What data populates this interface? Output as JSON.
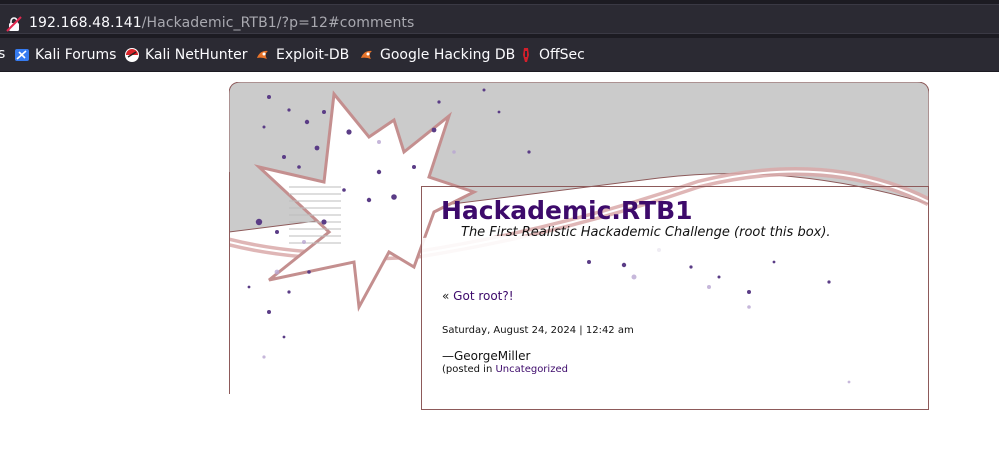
{
  "browser": {
    "url_host": "192.168.48.141",
    "url_path": "/Hackademic_RTB1/?p=12#comments",
    "bookmarks_edge": "s",
    "bookmarks": [
      {
        "label": "Kali Forums",
        "icon": "kali-forums-icon"
      },
      {
        "label": "Kali NetHunter",
        "icon": "kali-nethunter-icon"
      },
      {
        "label": "Exploit-DB",
        "icon": "exploit-db-icon"
      },
      {
        "label": "Google Hacking DB",
        "icon": "google-hacking-db-icon"
      },
      {
        "label": "OffSec",
        "icon": "offsec-icon"
      }
    ]
  },
  "blog": {
    "title": "Hackademic.RTB1",
    "description": "The First Realistic Hackademic Challenge (root this box)."
  },
  "post": {
    "prev_arrow": "«",
    "prev_link": "Got root?!",
    "date": "Saturday, August 24, 2024 | 12:42 am",
    "author": "—GeorgeMiller",
    "posted_in_prefix": "(posted in",
    "category": "Uncategorized"
  },
  "colors": {
    "title": "#3d0a6b",
    "link": "#3d0a6b",
    "border": "#8d5a5a",
    "chrome_bg": "#2b2a33"
  }
}
